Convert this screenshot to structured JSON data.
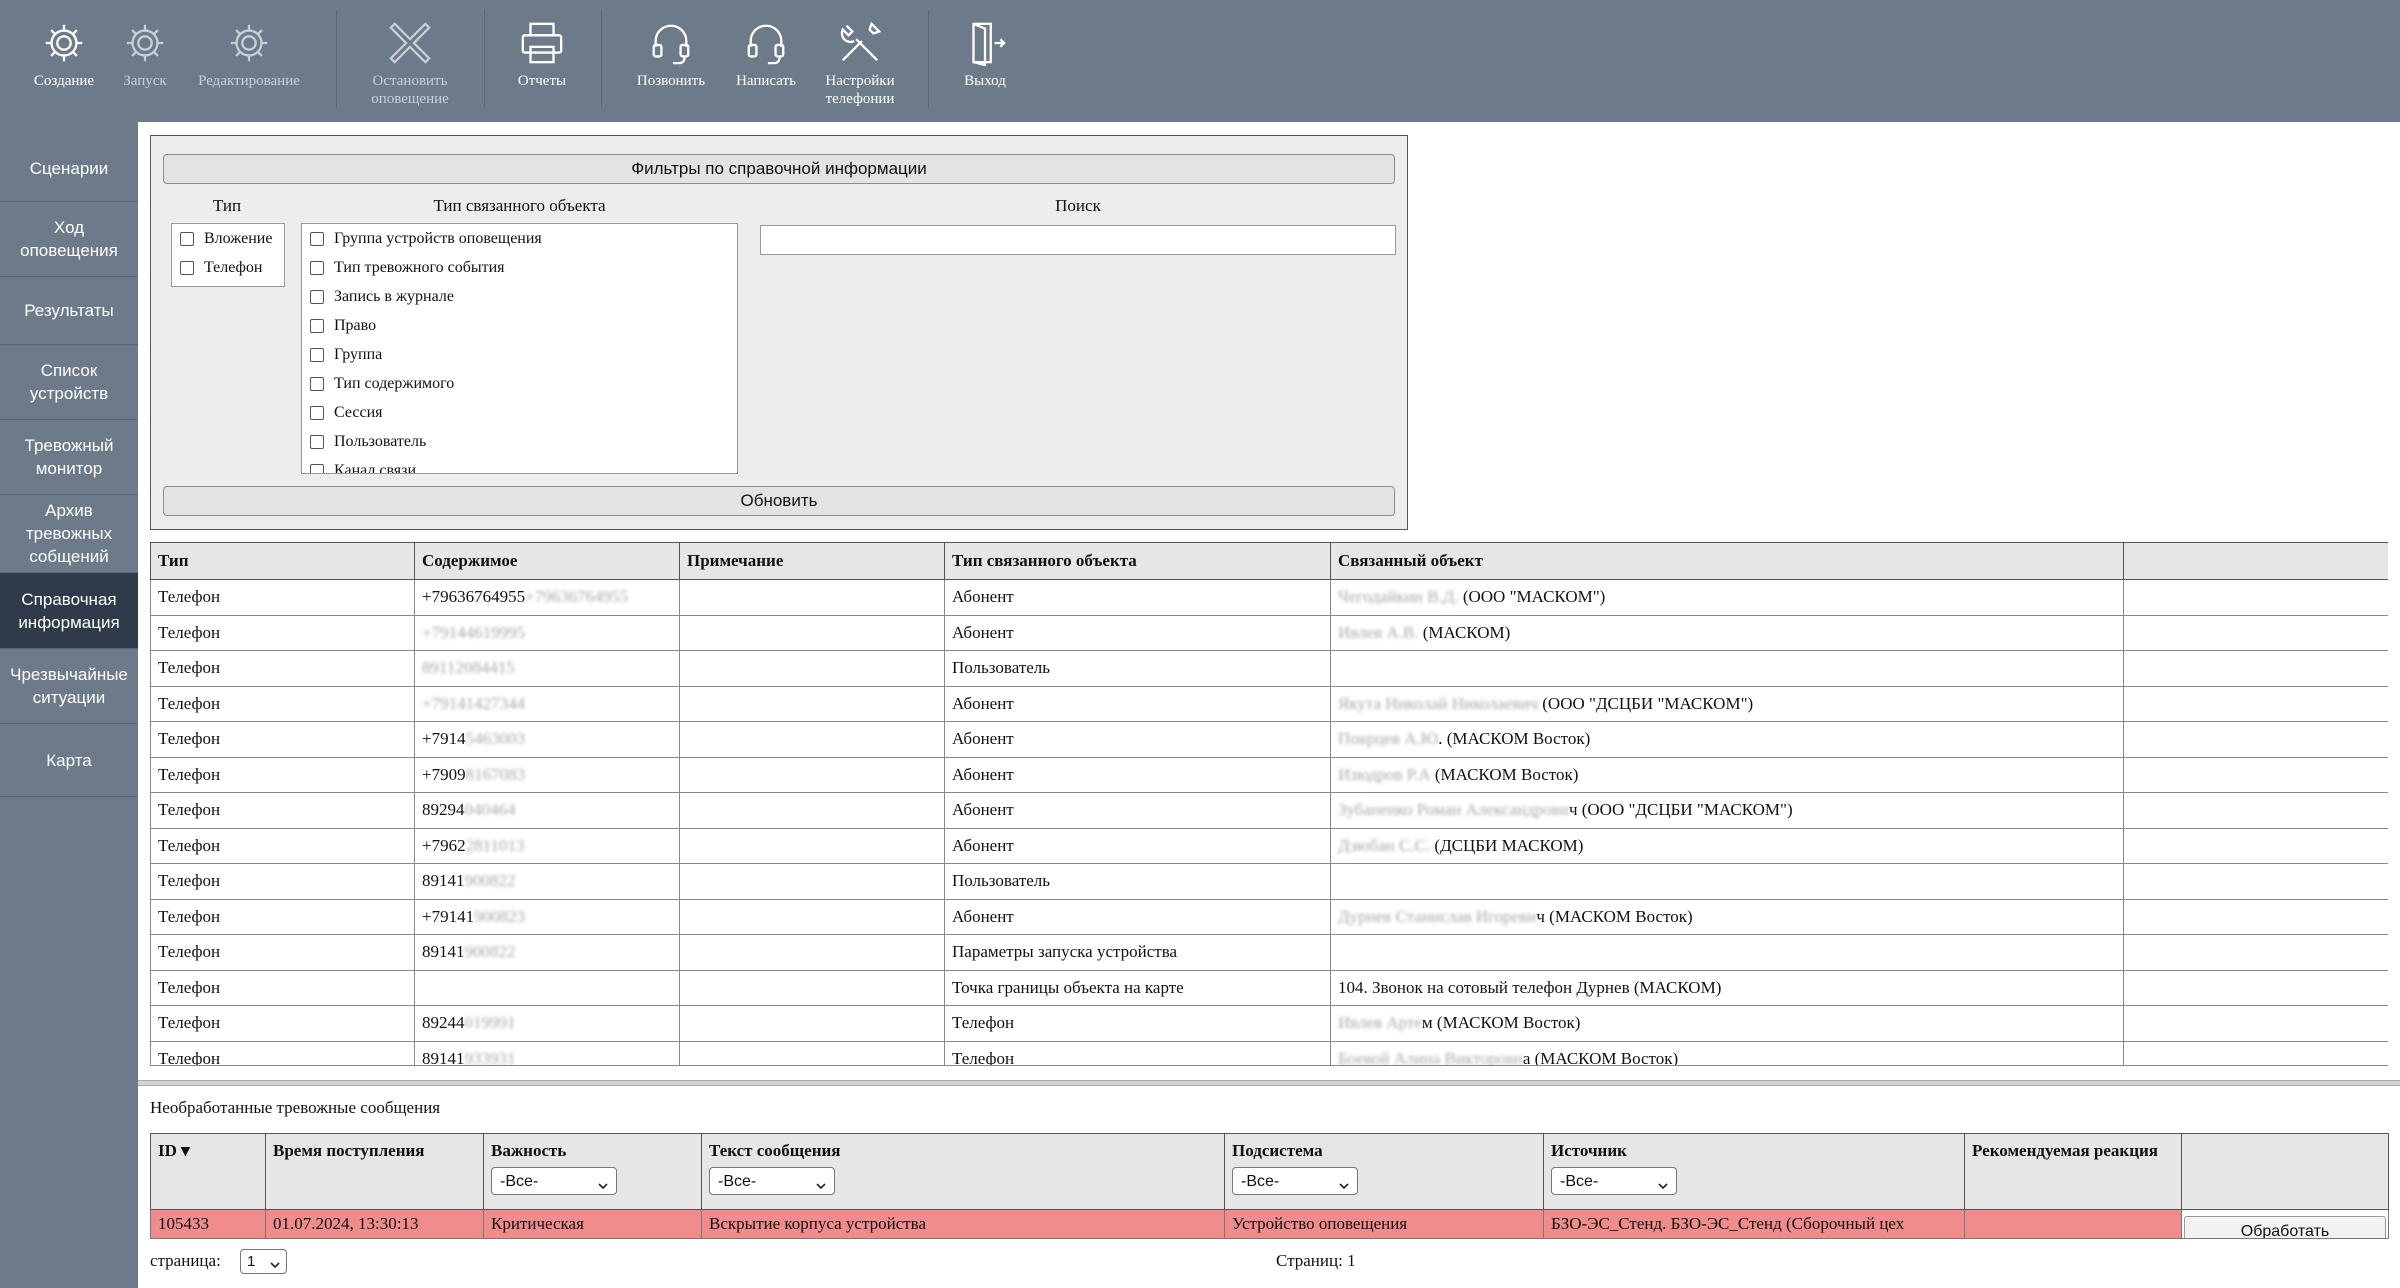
{
  "toolbar": {
    "create": "Создание",
    "start": "Запуск",
    "edit": "Редактирование",
    "stop": "Остановить\nоповещение",
    "reports": "Отчеты",
    "call": "Позвонить",
    "write": "Написать",
    "phone_settings": "Настройки\nтелефонии",
    "exit": "Выход"
  },
  "sidebar": {
    "items": [
      {
        "label": "Сценарии"
      },
      {
        "label": "Ход\nоповещения"
      },
      {
        "label": "Результаты"
      },
      {
        "label": "Список\nустройств"
      },
      {
        "label": "Тревожный\nмонитор"
      },
      {
        "label": "Архив\nтревожных\nсобщений"
      },
      {
        "label": "Справочная\nинформация"
      },
      {
        "label": "Чрезвычайные\nситуации"
      },
      {
        "label": "Карта"
      }
    ]
  },
  "filters": {
    "title": "Фильтры по справочной информации",
    "type_header": "Тип",
    "types": [
      "Вложение",
      "Телефон"
    ],
    "object_type_header": "Тип связанного объекта",
    "object_types": [
      "Группа устройств оповещения",
      "Тип тревожного события",
      "Запись в журнале",
      "Право",
      "Группа",
      "Тип содержимого",
      "Сессия",
      "Пользователь",
      "Канал связи"
    ],
    "search_header": "Поиск",
    "search_value": "",
    "refresh": "Обновить"
  },
  "main_table": {
    "headers": [
      "Тип",
      "Содержимое",
      "Примечание",
      "Тип связанного объекта",
      "Связанный объект",
      ""
    ],
    "rows": [
      {
        "type": "Телефон",
        "content": "+79636764955",
        "content_blur": "+79636764955",
        "content_tail": "",
        "note": "",
        "obj_type": "Абонент",
        "obj_blur": "Чегодайкин В.Д.",
        "obj_text": " (ООО \"МАСКОМ\")"
      },
      {
        "type": "Телефон",
        "content": "",
        "content_blur": "+79144619995",
        "content_tail": "",
        "note": "",
        "obj_type": "Абонент",
        "obj_blur": "Ивлев А.В.",
        "obj_text": " (МАСКОМ)"
      },
      {
        "type": "Телефон",
        "content": "",
        "content_blur": "89112084415",
        "content_tail": "",
        "note": "",
        "obj_type": "Пользователь",
        "obj_blur": "",
        "obj_text": ""
      },
      {
        "type": "Телефон",
        "content": "",
        "content_blur": "+79141427344",
        "content_tail": "",
        "note": "",
        "obj_type": "Абонент",
        "obj_blur": "Якута Николай Николаевич",
        "obj_text": " (ООО \"ДСЦБИ \"МАСКОМ\")"
      },
      {
        "type": "Телефон",
        "content": "+7914",
        "content_blur": "5463003",
        "content_tail": "",
        "note": "",
        "obj_type": "Абонент",
        "obj_blur": "Поврцев А.Ю",
        "obj_text": ". (МАСКОМ Восток)"
      },
      {
        "type": "Телефон",
        "content": "+7909",
        "content_blur": "8167083",
        "content_tail": "",
        "note": "",
        "obj_type": "Абонент",
        "obj_blur": "Изюдров Р.А",
        "obj_text": " (МАСКОМ Восток)"
      },
      {
        "type": "Телефон",
        "content": "89294",
        "content_blur": "040464",
        "content_tail": "",
        "note": "",
        "obj_type": "Абонент",
        "obj_blur": "Зубаненко Роман Александрови",
        "obj_text": "ч (ООО \"ДСЦБИ \"МАСКОМ\")"
      },
      {
        "type": "Телефон",
        "content": "+7962",
        "content_blur": "2811013",
        "content_tail": "",
        "note": "",
        "obj_type": "Абонент",
        "obj_blur": "Дзюбан С.С.",
        "obj_text": " (ДСЦБИ МАСКОМ)"
      },
      {
        "type": "Телефон",
        "content": "89141",
        "content_blur": "900822",
        "content_tail": "",
        "note": "",
        "obj_type": "Пользователь",
        "obj_blur": "",
        "obj_text": ""
      },
      {
        "type": "Телефон",
        "content": "+79141",
        "content_blur": "900823",
        "content_tail": "",
        "note": "",
        "obj_type": "Абонент",
        "obj_blur": "Дурнев Станислав Игореви",
        "obj_text": "ч (МАСКОМ Восток)"
      },
      {
        "type": "Телефон",
        "content": "89141",
        "content_blur": "900822",
        "content_tail": "",
        "note": "",
        "obj_type": "Параметры запуска устройства",
        "obj_blur": "",
        "obj_text": ""
      },
      {
        "type": "Телефон",
        "content": "",
        "content_blur": "",
        "content_tail": "",
        "note": "",
        "obj_type": "Точка границы объекта на карте",
        "obj_blur": "",
        "obj_text": "104. Звонок на сотовый телефон Дурнев (МАСКОМ)"
      },
      {
        "type": "Телефон",
        "content": "89244",
        "content_blur": "019991",
        "content_tail": "",
        "note": "",
        "obj_type": "Телефон",
        "obj_blur": "Ивлев Арте",
        "obj_text": "м (МАСКОМ Восток)"
      },
      {
        "type": "Телефон",
        "content": "89141",
        "content_blur": "933931",
        "content_tail": "",
        "note": "",
        "obj_type": "Телефон",
        "obj_blur": "Боевой Алина Викторовн",
        "obj_text": "а (МАСКОМ Восток)"
      }
    ]
  },
  "alarms": {
    "title": "Необработанные тревожные сообщения",
    "headers": {
      "id": "ID ▾",
      "time": "Время поступления",
      "severity": "Важность",
      "text": "Текст сообщения",
      "subsystem": "Подсистема",
      "source": "Источник",
      "reaction": "Рекомендуемая реакция"
    },
    "filter_all": "-Все-",
    "rows": [
      {
        "id": "105433",
        "time": "01.07.2024, 13:30:13",
        "severity": "Критическая",
        "text": "Вскрытие корпуса устройства",
        "subsystem": "Устройство оповещения",
        "source": "БЗО-ЭС_Стенд. БЗО-ЭС_Стенд (Сборочный цех",
        "reaction": "",
        "action": "Обработать"
      }
    ]
  },
  "pager": {
    "label": "страница:",
    "current": "1",
    "total_text": "Страниц: 1"
  }
}
